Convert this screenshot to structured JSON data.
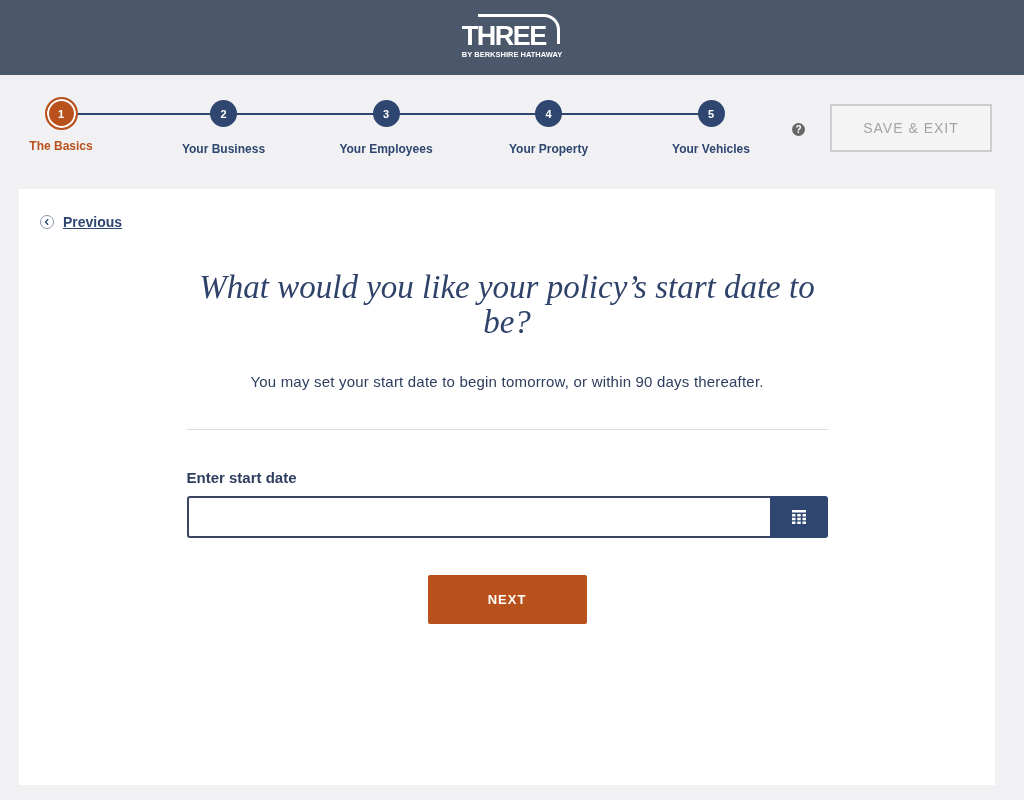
{
  "header": {
    "logo": {
      "wordmark": "THREE",
      "tagline": "BY BERKSHIRE HATHAWAY"
    }
  },
  "steps": [
    {
      "number": "1",
      "label": "The Basics",
      "selected": true
    },
    {
      "number": "2",
      "label": "Your Business",
      "selected": false
    },
    {
      "number": "3",
      "label": "Your Employees",
      "selected": false
    },
    {
      "number": "4",
      "label": "Your Property",
      "selected": false
    },
    {
      "number": "5",
      "label": "Your Vehicles",
      "selected": false
    }
  ],
  "help_icon": "?",
  "save_exit_button": "SAVE & EXIT",
  "back_link": "Previous",
  "question": {
    "title": "What would you like your policy’s start date to be?",
    "hint": "You may set your start date to begin tomorrow, or within 90 days thereafter."
  },
  "date_field": {
    "label": "Enter start date"
  },
  "next_button": "NEXT"
}
